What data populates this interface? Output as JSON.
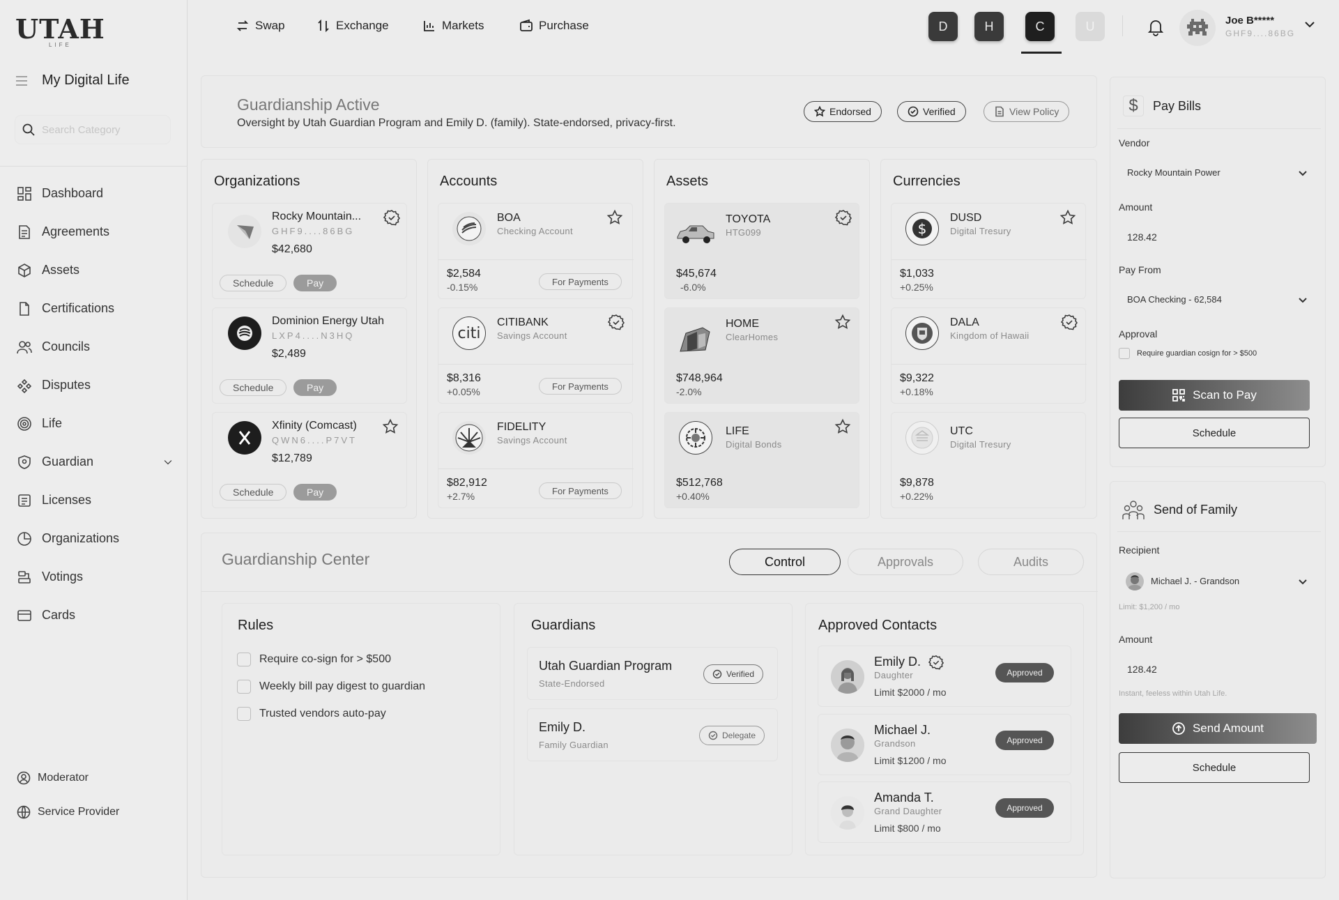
{
  "brand": {
    "logo": "UTAH",
    "logo_sub": "LIFE"
  },
  "sidebar": {
    "title": "My Digital Life",
    "search_placeholder": "Search Category",
    "items": [
      {
        "label": "Dashboard",
        "icon": "dashboard-icon"
      },
      {
        "label": "Agreements",
        "icon": "document-icon"
      },
      {
        "label": "Assets",
        "icon": "cube-icon"
      },
      {
        "label": "Certifications",
        "icon": "file-icon"
      },
      {
        "label": "Councils",
        "icon": "users-icon"
      },
      {
        "label": "Disputes",
        "icon": "nodes-icon"
      },
      {
        "label": "Life",
        "icon": "target-icon"
      },
      {
        "label": "Guardian",
        "icon": "shield-icon"
      },
      {
        "label": "Licenses",
        "icon": "license-icon"
      },
      {
        "label": "Organizations",
        "icon": "pie-icon"
      },
      {
        "label": "Votings",
        "icon": "votings-icon"
      },
      {
        "label": "Cards",
        "icon": "card-icon"
      }
    ],
    "footer": [
      {
        "label": "Moderator",
        "icon": "user-circle-icon"
      },
      {
        "label": "Service Provider",
        "icon": "globe-icon"
      }
    ]
  },
  "topbar": {
    "nav": [
      "Swap",
      "Exchange",
      "Markets",
      "Purchase"
    ],
    "user_switch": [
      "D",
      "H",
      "C",
      "U"
    ],
    "user": {
      "name": "Joe B*****",
      "id": "GHF9....86BG"
    }
  },
  "banner": {
    "title": "Guardianship Active",
    "subtitle": "Oversight by Utah Guardian Program and Emily D. (family). State-endorsed, privacy-first.",
    "badges": [
      "Endorsed",
      "Verified",
      "View Policy"
    ]
  },
  "organizations": {
    "title": "Organizations",
    "items": [
      {
        "name": "Rocky Mountain...",
        "code": "GHF9....86BG",
        "amount": "$42,680",
        "schedule": "Schedule",
        "pay": "Pay"
      },
      {
        "name": "Dominion Energy Utah",
        "code": "LXP4....N3HQ",
        "amount": "$2,489",
        "schedule": "Schedule",
        "pay": "Pay"
      },
      {
        "name": "Xfinity (Comcast)",
        "code": "QWN6....P7VT",
        "amount": "$12,789",
        "schedule": "Schedule",
        "pay": "Pay"
      }
    ]
  },
  "accounts": {
    "title": "Accounts",
    "items": [
      {
        "name": "BOA",
        "type": "Checking Account",
        "amount": "$2,584",
        "change": "-0.15%",
        "action": "For Payments"
      },
      {
        "name": "CITIBANK",
        "type": "Savings Account",
        "amount": "$8,316",
        "change": "+0.05%",
        "action": "For Payments"
      },
      {
        "name": "FIDELITY",
        "type": "Savings Account",
        "amount": "$82,912",
        "change": "+2.7%",
        "action": "For Payments"
      }
    ]
  },
  "assets": {
    "title": "Assets",
    "items": [
      {
        "name": "TOYOTA",
        "type": "HTG099",
        "amount": "$45,674",
        "change": "-6.0%"
      },
      {
        "name": "HOME",
        "type": "ClearHomes",
        "amount": "$748,964",
        "change": "-2.0%"
      },
      {
        "name": "LIFE",
        "type": "Digital Bonds",
        "amount": "$512,768",
        "change": "+0.40%"
      }
    ]
  },
  "currencies": {
    "title": "Currencies",
    "items": [
      {
        "name": "DUSD",
        "type": "Digital Tresury",
        "amount": "$1,033",
        "change": "+0.25%"
      },
      {
        "name": "DALA",
        "type": "Kingdom of Hawaii",
        "amount": "$9,322",
        "change": "+0.18%"
      },
      {
        "name": "UTC",
        "type": "Digital Tresury",
        "amount": "$9,878",
        "change": "+0.22%"
      }
    ]
  },
  "guardianship_center": {
    "title": "Guardianship Center",
    "tabs": [
      "Control",
      "Approvals",
      "Audits"
    ],
    "rules": {
      "title": "Rules",
      "items": [
        "Require co-sign for > $500",
        "Weekly bill pay digest to guardian",
        "Trusted vendors auto-pay"
      ]
    },
    "guardians": {
      "title": "Guardians",
      "items": [
        {
          "name": "Utah Guardian Program",
          "role": "State-Endorsed",
          "action": "Verified"
        },
        {
          "name": "Emily D.",
          "role": "Family Guardian",
          "action": "Delegate"
        }
      ]
    },
    "contacts": {
      "title": "Approved Contacts",
      "items": [
        {
          "name": "Emily D.",
          "relation": "Daughter",
          "limit": "Limit $2000 / mo",
          "status": "Approved"
        },
        {
          "name": "Michael J.",
          "relation": "Grandson",
          "limit": "Limit $1200 / mo",
          "status": "Approved"
        },
        {
          "name": "Amanda T.",
          "relation": "Grand Daughter",
          "limit": "Limit $800 / mo",
          "status": "Approved"
        }
      ]
    }
  },
  "pay_bills": {
    "title": "Pay Bills",
    "vendor_label": "Vendor",
    "vendor": "Rocky Mountain Power",
    "amount_label": "Amount",
    "amount": "128.42",
    "from_label": "Pay From",
    "from": "BOA Checking - 62,584",
    "approval_label": "Approval",
    "approval_text": "Require guardian cosign for > $500",
    "scan_label": "Scan to Pay",
    "schedule_label": "Schedule"
  },
  "send_family": {
    "title": "Send of Family",
    "recipient_label": "Recipient",
    "recipient": "Michael J. - Grandson",
    "limit_hint": "Limit: $1,200 / mo",
    "amount_label": "Amount",
    "amount": "128.42",
    "note": "Instant, feeless within Utah Life.",
    "send_label": "Send Amount",
    "schedule_label": "Schedule"
  },
  "colors": {
    "background": "#ececec",
    "accent_dark": "#1f1f1f",
    "approved_badge": "#555555"
  }
}
